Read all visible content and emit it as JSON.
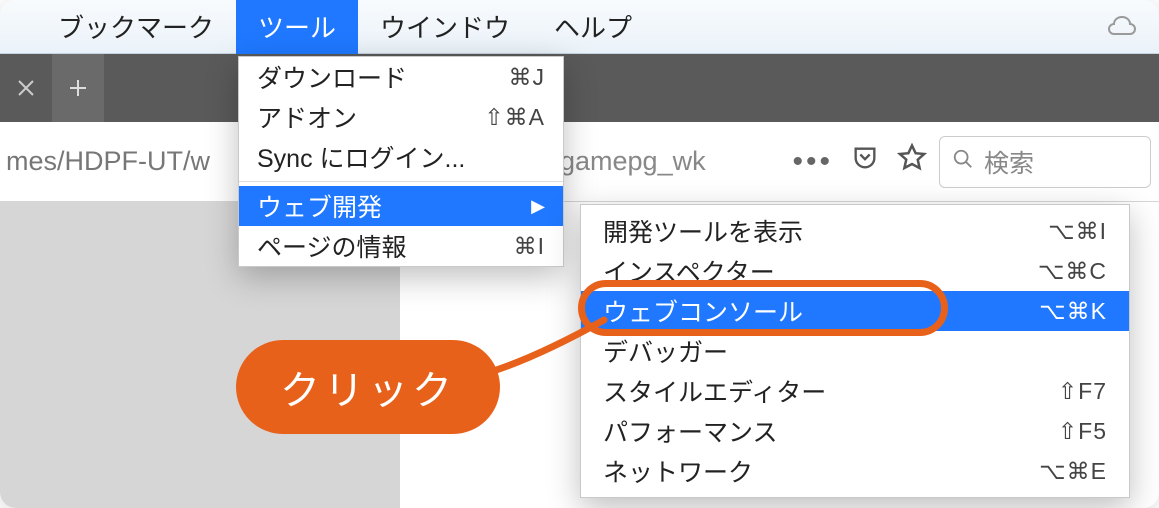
{
  "menubar": {
    "bookmarks": "ブックマーク",
    "tools": "ツール",
    "window": "ウインドウ",
    "help": "ヘルプ"
  },
  "toolsMenu": {
    "downloads": {
      "label": "ダウンロード",
      "shortcut": "⌘J"
    },
    "addons": {
      "label": "アドオン",
      "shortcut": "⇧⌘A"
    },
    "syncLogin": {
      "label": "Sync にログイン..."
    },
    "webDev": {
      "label": "ウェブ開発"
    },
    "pageInfo": {
      "label": "ページの情報",
      "shortcut": "⌘I"
    }
  },
  "webDevMenu": {
    "toggleTools": {
      "label": "開発ツールを表示",
      "shortcut": "⌥⌘I"
    },
    "inspector": {
      "label": "インスペクター",
      "shortcut": "⌥⌘C"
    },
    "webConsole": {
      "label": "ウェブコンソール",
      "shortcut": "⌥⌘K"
    },
    "debugger": {
      "label": "デバッガー"
    },
    "styleEditor": {
      "label": "スタイルエディター",
      "shortcut": "⇧F7"
    },
    "performance": {
      "label": "パフォーマンス",
      "shortcut": "⇧F5"
    },
    "network": {
      "label": "ネットワーク",
      "shortcut": "⌥⌘E"
    }
  },
  "addressbar": {
    "urlLeft": "mes/HDPF-UT/w",
    "urlMid": "gamepg_wk",
    "ellipsis": "•••"
  },
  "search": {
    "placeholder": "検索"
  },
  "annotation": {
    "clickLabel": "クリック"
  }
}
